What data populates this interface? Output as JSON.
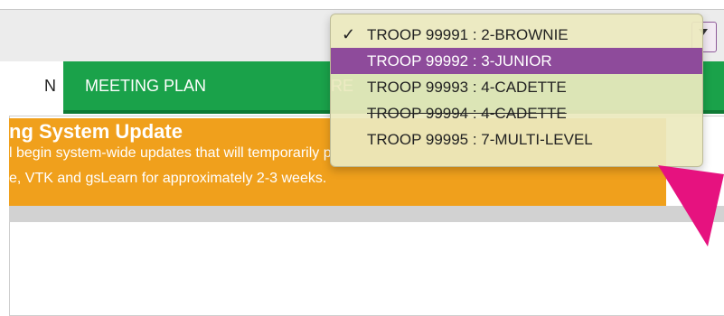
{
  "tabs": {
    "partial_active_label": "N",
    "meeting_plan_label": "MEETING PLAN",
    "partial_next_label": "RE"
  },
  "troop_selector": {
    "selected": "TROOP 99991 : 2-BROWNIE",
    "options": [
      {
        "label": "TROOP 99991 : 2-BROWNIE",
        "checked": true
      },
      {
        "label": "TROOP 99992 : 3-JUNIOR",
        "highlighted": true
      },
      {
        "label": "TROOP 99993 : 4-CADETTE"
      },
      {
        "label": "TROOP 99994 : 4-CADETTE"
      },
      {
        "label": "TROOP 99995 : 7-MULTI-LEVEL"
      }
    ]
  },
  "banner": {
    "title": "ng System Update",
    "line1": "l begin system-wide updates that wi",
    "line1_tail": "ll temporarily p",
    "line2": "e, VTK and gsLearn for approximately 2-3 weeks."
  },
  "colors": {
    "tab_green": "#1aa24a",
    "banner_orange": "#f0a01c",
    "highlight_purple": "#8e4b9b",
    "pointer_magenta": "#e6127f"
  },
  "icons": {
    "check": "✓"
  }
}
